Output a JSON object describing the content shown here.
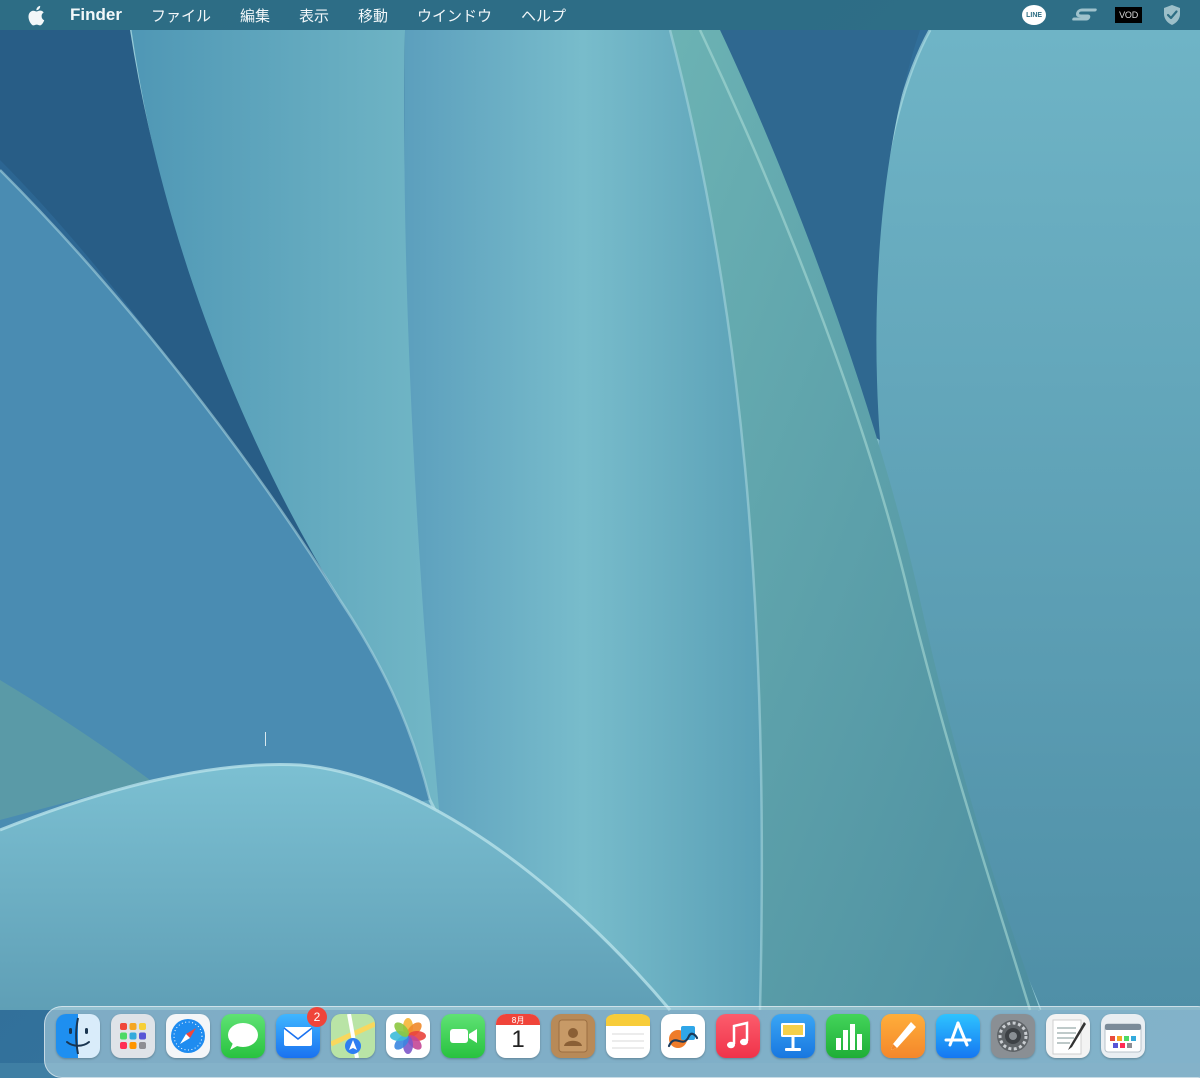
{
  "menubar": {
    "apple_icon": "apple-logo-icon",
    "app_name": "Finder",
    "menus": [
      "ファイル",
      "編集",
      "表示",
      "移動",
      "ウインドウ",
      "ヘルプ"
    ],
    "status_items": {
      "line_label": "LINE",
      "vod_label": "VOD",
      "icons": [
        "line-icon",
        "s-sync-icon",
        "vod-icon",
        "shield-check-icon"
      ]
    }
  },
  "colors": {
    "menubar_bg": "#2e6e84",
    "wallpaper_dark": "#2f6d94",
    "wallpaper_light": "#7cc3d0",
    "badge": "#f0443a"
  },
  "dock": {
    "mail_badge": "2",
    "calendar_month": "8月",
    "calendar_day": "1",
    "apps": [
      "finder",
      "launchpad",
      "safari",
      "messages",
      "mail",
      "maps",
      "photos",
      "facetime",
      "calendar",
      "contacts",
      "notes",
      "freeform",
      "music",
      "keynote",
      "numbers",
      "pages",
      "app-store",
      "system-settings",
      "textedit",
      "screenshot-preview"
    ]
  }
}
